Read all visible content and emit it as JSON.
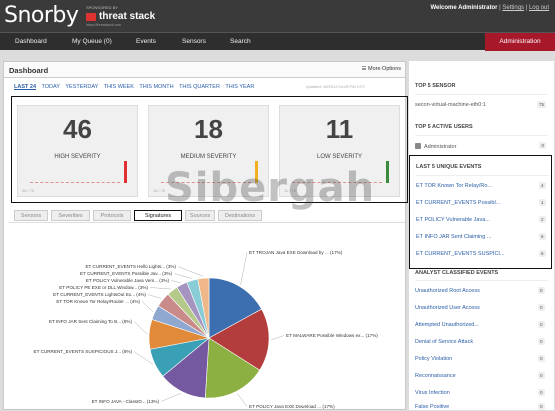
{
  "app": {
    "logo": "Snorby",
    "sponsor": "SPONSORED BY",
    "sponsor_name": "threat stack",
    "sponsor_sub": "https://threatstack.com"
  },
  "welcome": {
    "text": "Welcome Administrator",
    "sep": "|",
    "settings": "Settings",
    "logout": "Log out"
  },
  "nav": {
    "items": [
      "Dashboard",
      "My Queue (0)",
      "Events",
      "Sensors",
      "Search"
    ],
    "admin": "Administration"
  },
  "dashboard": {
    "title": "Dashboard",
    "more_options": "More Options",
    "ranges": [
      "LAST 24",
      "TODAY",
      "YESTERDAY",
      "THIS WEEK",
      "THIS MONTH",
      "THIS QUARTER",
      "THIS YEAR"
    ],
    "active_range": "LAST 24",
    "updated": "Updated: 06/2013 04:08 PM UTC",
    "severity": [
      {
        "value": "46",
        "label": "HIGH SEVERITY",
        "count": "46 / 75",
        "color": "#e03030"
      },
      {
        "value": "18",
        "label": "MEDIUM SEVERITY",
        "count": "18 / 75",
        "color": "#f0b020"
      },
      {
        "value": "11",
        "label": "LOW SEVERITY",
        "count": "11 / 75",
        "color": "#3a8a3a"
      }
    ],
    "tabs": [
      "Sensors",
      "Severities",
      "Protocols",
      "Signatures",
      "Sources",
      "Destinations"
    ],
    "active_tab": "Signatures"
  },
  "chart_data": {
    "type": "pie",
    "slices": [
      {
        "label": "ET TROJAN Java EXE Download by ... (17%)",
        "value": 17,
        "color": "#3b6fb0"
      },
      {
        "label": "ET MALWARE Possible Windows ex... (17%)",
        "value": 17,
        "color": "#b33d3d"
      },
      {
        "label": "ET POLICY Java EXE Download ... (17%)",
        "value": 17,
        "color": "#8cb042"
      },
      {
        "label": "ET INFO JAVA - ClassID... (13%)",
        "value": 13,
        "color": "#7459a0"
      },
      {
        "label": "ET CURRENT_EVENTS SUSPICIOUS J... (8%)",
        "value": 8,
        "color": "#3aa0b5"
      },
      {
        "label": "ET INFO JAR Sent Claiming To B... (8%)",
        "value": 8,
        "color": "#e08a3a"
      },
      {
        "label": "ET TOR Known Tor Relay/Router ... (4%)",
        "value": 4,
        "color": "#8fa8d0"
      },
      {
        "label": "ET CURRENT_EVENTS LightsOut Ex... (4%)",
        "value": 4,
        "color": "#c98a8a"
      },
      {
        "label": "ET POLICY PE EXE or DLL Window... (3%)",
        "value": 3,
        "color": "#b5c98a"
      },
      {
        "label": "ET POLICY Vulnerable Java Vers... (3%)",
        "value": 3,
        "color": "#a694c0"
      },
      {
        "label": "ET CURRENT_EVENTS Possible Jav... (3%)",
        "value": 3,
        "color": "#8accd5"
      },
      {
        "label": "ET CURRENT_EVENTS Hello Lights... (3%)",
        "value": 3,
        "color": "#f0b88a"
      }
    ]
  },
  "sidebar": {
    "top_sensor_title": "TOP 5 SENSOR",
    "top_sensor": {
      "name": "secon-virtual-machine-eth0:1",
      "count": "75"
    },
    "active_users_title": "TOP 5 ACTIVE USERS",
    "active_user": {
      "name": "Administrator",
      "count": "0"
    },
    "unique_title": "LAST 5 UNIQUE EVENTS",
    "unique": [
      {
        "name": "ET TOR Known Tor Relay/Ro...",
        "count": "4"
      },
      {
        "name": "ET CURRENT_EVENTS Possibl...",
        "count": "1"
      },
      {
        "name": "ET POLICY Vulnerable Java...",
        "count": "2"
      },
      {
        "name": "ET INFO JAR Sent Claiming ...",
        "count": "6"
      },
      {
        "name": "ET CURRENT_EVENTS SUSPICI...",
        "count": "6"
      }
    ],
    "classified_title": "ANALYST CLASSIFIED EVENTS",
    "classified": [
      {
        "name": "Unauthorized Root Access",
        "count": "0"
      },
      {
        "name": "Unauthorized User Access",
        "count": "0"
      },
      {
        "name": "Attempted Unauthorized...",
        "count": "0"
      },
      {
        "name": "Denial of Service Attack",
        "count": "0"
      },
      {
        "name": "Policy Violation",
        "count": "0"
      },
      {
        "name": "Reconnaissance",
        "count": "0"
      },
      {
        "name": "Virus Infection",
        "count": "0"
      },
      {
        "name": "False Positive",
        "count": "0"
      }
    ]
  },
  "watermark": "Sibergah"
}
